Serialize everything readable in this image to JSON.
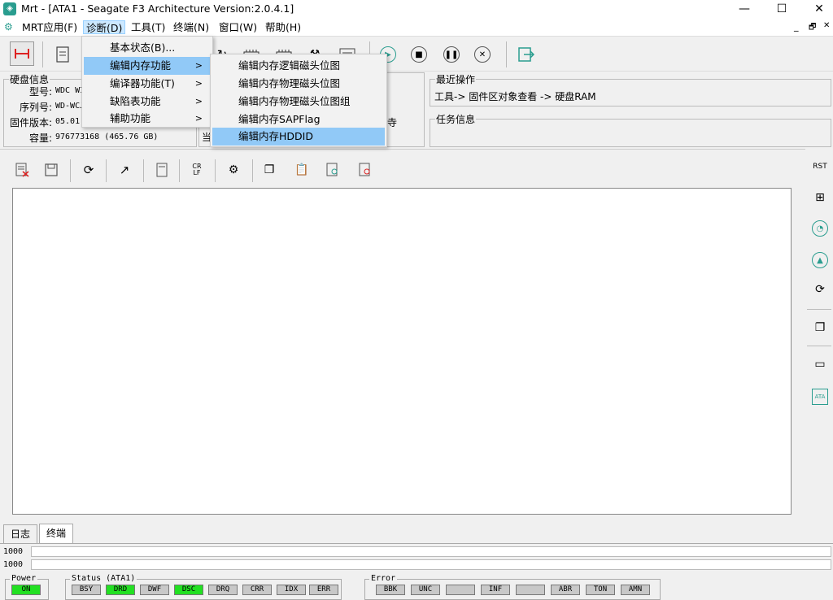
{
  "window": {
    "title": "Mrt - [ATA1 - Seagate F3 Architecture Version:2.0.4.1]",
    "minimize": "—",
    "maximize": "☐",
    "close": "✕"
  },
  "menubar": {
    "items": [
      {
        "label": "MRT应用(F)"
      },
      {
        "label": "诊断(D)"
      },
      {
        "label": "工具(T)"
      },
      {
        "label": "终端(N)"
      },
      {
        "label": "窗口(W)"
      },
      {
        "label": "帮助(H)"
      }
    ],
    "mdi_minimize": "_",
    "mdi_restore": "🗗",
    "mdi_close": "✕"
  },
  "diag_menu": {
    "items": [
      {
        "label": "基本状态(B)..."
      },
      {
        "label": "编辑内存功能",
        "arrow": ">"
      },
      {
        "label": "编译器功能(T)",
        "arrow": ">"
      },
      {
        "label": "缺陷表功能",
        "arrow": ">"
      },
      {
        "label": "辅助功能",
        "arrow": ">"
      }
    ]
  },
  "mem_submenu": {
    "items": [
      {
        "label": "编辑内存逻辑磁头位图"
      },
      {
        "label": "编辑内存物理磁头位图"
      },
      {
        "label": "编辑内存物理磁头位图组"
      },
      {
        "label": "编辑内存SAPFlag"
      },
      {
        "label": "编辑内存HDDID"
      }
    ]
  },
  "disk_info": {
    "legend": "硬盘信息",
    "model_label": "型号:",
    "model_value": "WDC WI",
    "serial_label": "序列号:",
    "serial_value": "WD-WCJ",
    "firmware_label": "固件版本:",
    "firmware_value": "05.01",
    "capacity_label": "容量:",
    "capacity_value": "976773168 (465.76 GB)"
  },
  "partial_text": {
    "dang": "当",
    "shi": "寺"
  },
  "recent_ops": {
    "legend": "最近操作",
    "text": "工具-> 固件区对象查看 -> 硬盘RAM"
  },
  "task_info": {
    "legend": "任务信息"
  },
  "right_toolbar": {
    "rst": "RST",
    "ata": "ATA"
  },
  "tabs": [
    {
      "label": "日志"
    },
    {
      "label": "终端"
    }
  ],
  "counters": [
    "1000",
    "1000"
  ],
  "power": {
    "legend": "Power",
    "on": "ON"
  },
  "status": {
    "legend": "Status (ATA1)",
    "flags": [
      "BSY",
      "DRD",
      "DWF",
      "DSC",
      "DRQ",
      "CRR",
      "IDX",
      "ERR"
    ],
    "active": [
      "DRD",
      "DSC"
    ]
  },
  "error": {
    "legend": "Error",
    "flags": [
      "BBK",
      "UNC",
      "",
      "INF",
      "",
      "ABR",
      "TON",
      "AMN"
    ]
  },
  "colors": {
    "indicator_on": "#22e022",
    "indicator_off": "#c8c8c8",
    "menu_highlight": "#91c9f7"
  }
}
